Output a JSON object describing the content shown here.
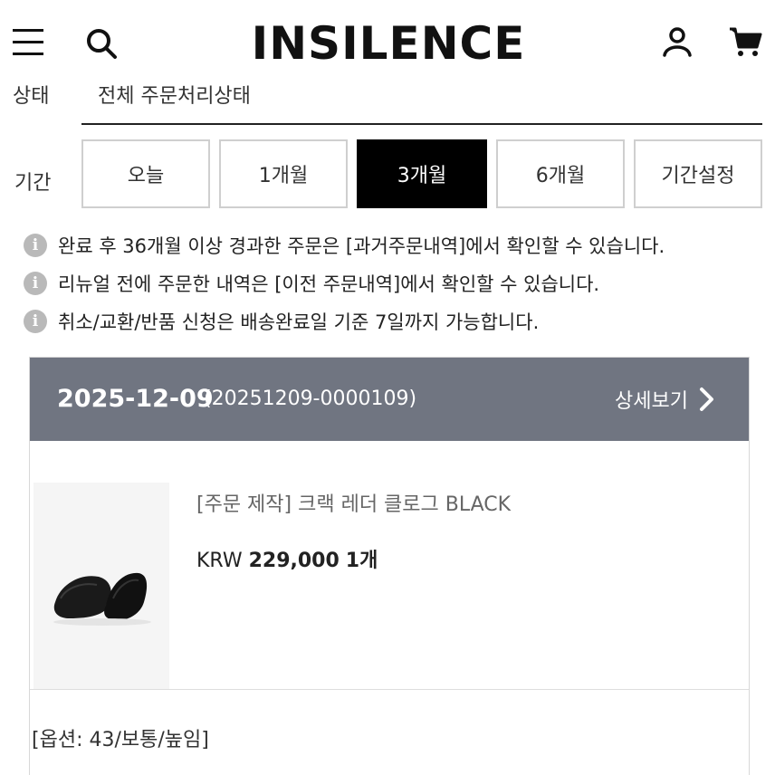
{
  "header": {
    "logo": "INSILENCE",
    "icons": [
      "hamburger-menu-icon",
      "search-icon",
      "user-icon",
      "cart-icon"
    ]
  },
  "filters": {
    "status_label": "상태",
    "status_value": "전체 주문처리상태",
    "period_label": "기간",
    "period_buttons": [
      {
        "label": "오늘",
        "active": false
      },
      {
        "label": "1개월",
        "active": false
      },
      {
        "label": "3개월",
        "active": true
      },
      {
        "label": "6개월",
        "active": false
      },
      {
        "label": "기간설정",
        "active": false
      }
    ]
  },
  "notices": [
    "완료 후 36개월 이상 경과한 주문은 [과거주문내역]에서 확인할 수 있습니다.",
    "리뉴얼 전에 주문한 내역은 [이전 주문내역]에서 확인할 수 있습니다.",
    "취소/교환/반품 신청은 배송완료일 기준 7일까지 가능합니다."
  ],
  "order": {
    "date": "2025-12-09",
    "order_number": "(20251209-0000109)",
    "detail_label": "상세보기",
    "product": {
      "name": "[주문 제작] 크랙 레더 클로그 BLACK",
      "currency": "KRW",
      "price": "229,000",
      "quantity": "1개",
      "image": "black-leather-clog-shoes"
    },
    "option": "[옵션: 43/보통/높임]"
  },
  "colors": {
    "order_header_bg": "#707581",
    "active_button_bg": "#000000",
    "info_icon": "#b9b9b9"
  }
}
